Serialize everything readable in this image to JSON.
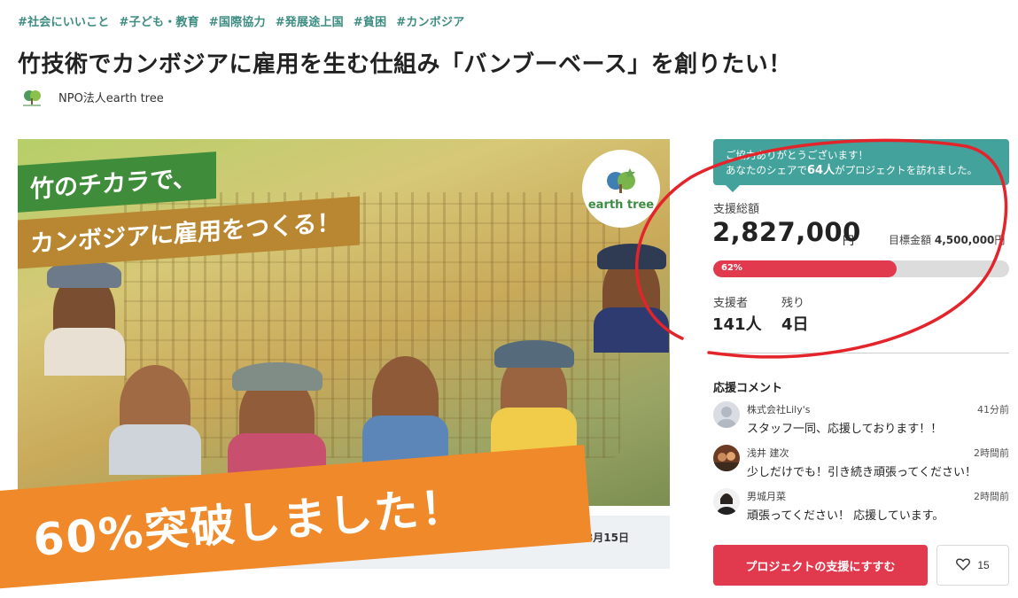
{
  "tags": [
    "#社会にいいこと",
    "#子ども・教育",
    "#国際協力",
    "#発展途上国",
    "#貧困",
    "#カンボジア"
  ],
  "title": "竹技術でカンボジアに雇用を生む仕組み「バンブーベース」を創りたい！",
  "owner": {
    "name": "NPO法人earth tree",
    "logo_text": "earth tree"
  },
  "hero": {
    "line1": "竹のチカラで、",
    "line2": "カンボジアに雇用をつくる！",
    "logo_text": "earth tree"
  },
  "strip": {
    "date_fragment": "3月15日"
  },
  "banner": {
    "text": "60%突破しました！"
  },
  "thanks": {
    "line1": "ご協力ありがとうございます！",
    "line2_prefix": "あなたのシェアで",
    "line2_count": "64人",
    "line2_suffix": "がプロジェクトを訪れました。"
  },
  "funding": {
    "total_label": "支援総額",
    "total_amount": "2,827,000",
    "unit": "円",
    "goal_label": "目標金額",
    "goal_amount": "4,500,000",
    "goal_unit": "円",
    "progress_text": "62%",
    "progress_fraction": 0.62
  },
  "stats": {
    "supporters_label": "支援者",
    "supporters_value": "141人",
    "remaining_label": "残り",
    "remaining_value": "4日"
  },
  "comments": {
    "title": "応援コメント",
    "items": [
      {
        "name": "株式会社Lily's",
        "time": "41分前",
        "text": "スタッフ一同、応援しております！！"
      },
      {
        "name": "浅井 建次",
        "time": "2時間前",
        "text": "少しだけでも！引き続き頑張ってください！"
      },
      {
        "name": "男城月菜",
        "time": "2時間前",
        "text": "頑張ってください！ 応援しています。"
      }
    ]
  },
  "actions": {
    "support_label": "プロジェクトの支援にすすむ",
    "like_count": "15"
  },
  "colors": {
    "accent_red": "#e13a4f",
    "teal": "#43a39c",
    "tag_green": "#3c8c82",
    "banner_orange": "#f0892a"
  }
}
